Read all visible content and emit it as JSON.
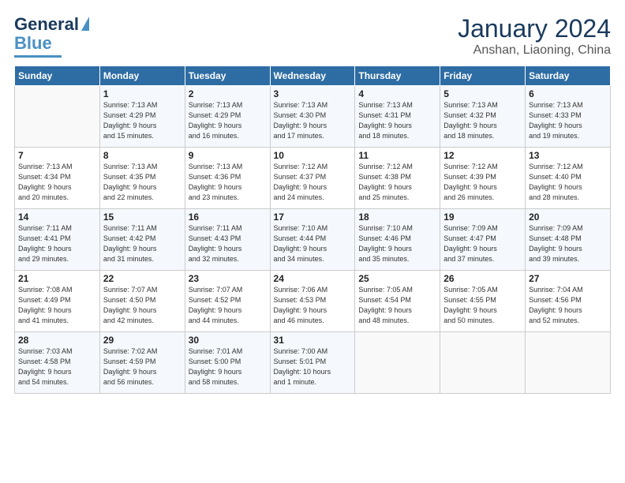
{
  "header": {
    "logo_line1": "General",
    "logo_line2": "Blue",
    "title": "January 2024",
    "subtitle": "Anshan, Liaoning, China"
  },
  "days_of_week": [
    "Sunday",
    "Monday",
    "Tuesday",
    "Wednesday",
    "Thursday",
    "Friday",
    "Saturday"
  ],
  "weeks": [
    [
      {
        "day": "",
        "info": ""
      },
      {
        "day": "1",
        "info": "Sunrise: 7:13 AM\nSunset: 4:29 PM\nDaylight: 9 hours\nand 15 minutes."
      },
      {
        "day": "2",
        "info": "Sunrise: 7:13 AM\nSunset: 4:29 PM\nDaylight: 9 hours\nand 16 minutes."
      },
      {
        "day": "3",
        "info": "Sunrise: 7:13 AM\nSunset: 4:30 PM\nDaylight: 9 hours\nand 17 minutes."
      },
      {
        "day": "4",
        "info": "Sunrise: 7:13 AM\nSunset: 4:31 PM\nDaylight: 9 hours\nand 18 minutes."
      },
      {
        "day": "5",
        "info": "Sunrise: 7:13 AM\nSunset: 4:32 PM\nDaylight: 9 hours\nand 18 minutes."
      },
      {
        "day": "6",
        "info": "Sunrise: 7:13 AM\nSunset: 4:33 PM\nDaylight: 9 hours\nand 19 minutes."
      }
    ],
    [
      {
        "day": "7",
        "info": "Sunrise: 7:13 AM\nSunset: 4:34 PM\nDaylight: 9 hours\nand 20 minutes."
      },
      {
        "day": "8",
        "info": "Sunrise: 7:13 AM\nSunset: 4:35 PM\nDaylight: 9 hours\nand 22 minutes."
      },
      {
        "day": "9",
        "info": "Sunrise: 7:13 AM\nSunset: 4:36 PM\nDaylight: 9 hours\nand 23 minutes."
      },
      {
        "day": "10",
        "info": "Sunrise: 7:12 AM\nSunset: 4:37 PM\nDaylight: 9 hours\nand 24 minutes."
      },
      {
        "day": "11",
        "info": "Sunrise: 7:12 AM\nSunset: 4:38 PM\nDaylight: 9 hours\nand 25 minutes."
      },
      {
        "day": "12",
        "info": "Sunrise: 7:12 AM\nSunset: 4:39 PM\nDaylight: 9 hours\nand 26 minutes."
      },
      {
        "day": "13",
        "info": "Sunrise: 7:12 AM\nSunset: 4:40 PM\nDaylight: 9 hours\nand 28 minutes."
      }
    ],
    [
      {
        "day": "14",
        "info": "Sunrise: 7:11 AM\nSunset: 4:41 PM\nDaylight: 9 hours\nand 29 minutes."
      },
      {
        "day": "15",
        "info": "Sunrise: 7:11 AM\nSunset: 4:42 PM\nDaylight: 9 hours\nand 31 minutes."
      },
      {
        "day": "16",
        "info": "Sunrise: 7:11 AM\nSunset: 4:43 PM\nDaylight: 9 hours\nand 32 minutes."
      },
      {
        "day": "17",
        "info": "Sunrise: 7:10 AM\nSunset: 4:44 PM\nDaylight: 9 hours\nand 34 minutes."
      },
      {
        "day": "18",
        "info": "Sunrise: 7:10 AM\nSunset: 4:46 PM\nDaylight: 9 hours\nand 35 minutes."
      },
      {
        "day": "19",
        "info": "Sunrise: 7:09 AM\nSunset: 4:47 PM\nDaylight: 9 hours\nand 37 minutes."
      },
      {
        "day": "20",
        "info": "Sunrise: 7:09 AM\nSunset: 4:48 PM\nDaylight: 9 hours\nand 39 minutes."
      }
    ],
    [
      {
        "day": "21",
        "info": "Sunrise: 7:08 AM\nSunset: 4:49 PM\nDaylight: 9 hours\nand 41 minutes."
      },
      {
        "day": "22",
        "info": "Sunrise: 7:07 AM\nSunset: 4:50 PM\nDaylight: 9 hours\nand 42 minutes."
      },
      {
        "day": "23",
        "info": "Sunrise: 7:07 AM\nSunset: 4:52 PM\nDaylight: 9 hours\nand 44 minutes."
      },
      {
        "day": "24",
        "info": "Sunrise: 7:06 AM\nSunset: 4:53 PM\nDaylight: 9 hours\nand 46 minutes."
      },
      {
        "day": "25",
        "info": "Sunrise: 7:05 AM\nSunset: 4:54 PM\nDaylight: 9 hours\nand 48 minutes."
      },
      {
        "day": "26",
        "info": "Sunrise: 7:05 AM\nSunset: 4:55 PM\nDaylight: 9 hours\nand 50 minutes."
      },
      {
        "day": "27",
        "info": "Sunrise: 7:04 AM\nSunset: 4:56 PM\nDaylight: 9 hours\nand 52 minutes."
      }
    ],
    [
      {
        "day": "28",
        "info": "Sunrise: 7:03 AM\nSunset: 4:58 PM\nDaylight: 9 hours\nand 54 minutes."
      },
      {
        "day": "29",
        "info": "Sunrise: 7:02 AM\nSunset: 4:59 PM\nDaylight: 9 hours\nand 56 minutes."
      },
      {
        "day": "30",
        "info": "Sunrise: 7:01 AM\nSunset: 5:00 PM\nDaylight: 9 hours\nand 58 minutes."
      },
      {
        "day": "31",
        "info": "Sunrise: 7:00 AM\nSunset: 5:01 PM\nDaylight: 10 hours\nand 1 minute."
      },
      {
        "day": "",
        "info": ""
      },
      {
        "day": "",
        "info": ""
      },
      {
        "day": "",
        "info": ""
      }
    ]
  ]
}
